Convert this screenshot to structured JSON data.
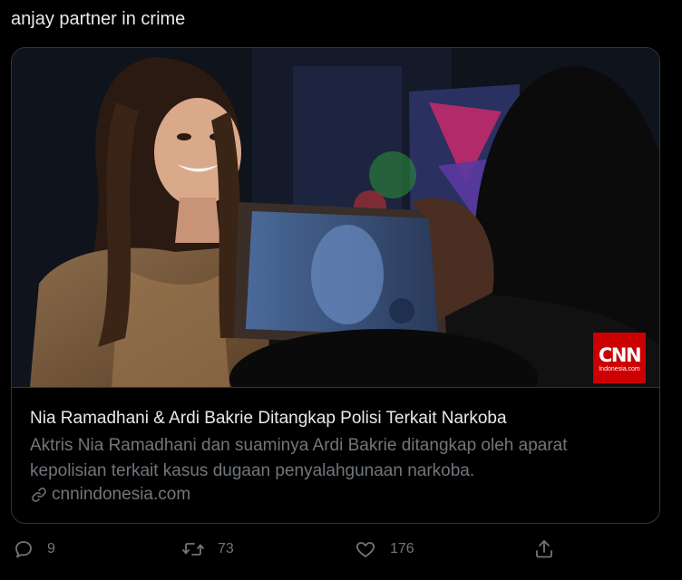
{
  "tweet": {
    "text": "anjay partner in crime"
  },
  "card": {
    "title": "Nia Ramadhani & Ardi Bakrie Ditangkap Polisi Terkait Narkoba",
    "description": "Aktris Nia Ramadhani dan suaminya Ardi Bakrie ditangkap oleh aparat kepolisian terkait kasus dugaan penyalahgunaan narkoba.",
    "domain": "cnnindonesia.com",
    "logo_main": "CNN",
    "logo_sub": "Indonesia.com"
  },
  "actions": {
    "reply_count": "9",
    "retweet_count": "73",
    "like_count": "176"
  },
  "icons": {
    "reply": "reply-icon",
    "retweet": "retweet-icon",
    "like": "heart-icon",
    "share": "share-icon",
    "link": "link-icon"
  },
  "colors": {
    "background": "#000000",
    "text": "#e7e9ea",
    "muted": "#71767b",
    "border": "#333639",
    "cnn_red": "#cc0000"
  }
}
